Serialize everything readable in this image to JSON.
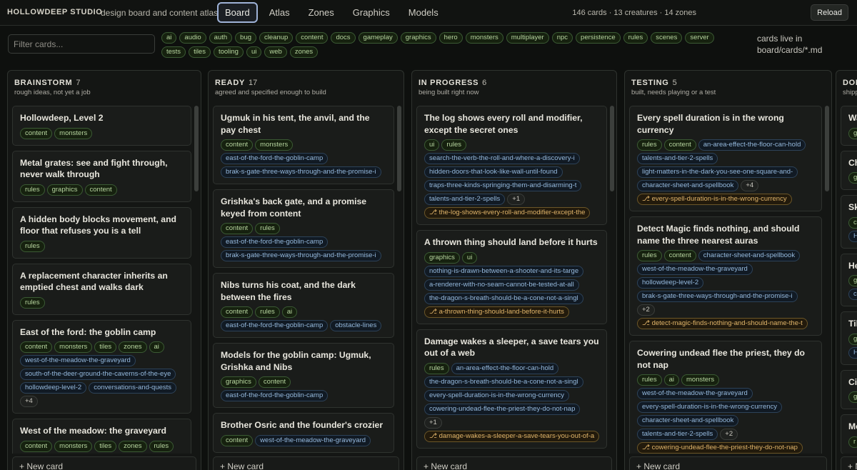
{
  "header": {
    "brand": "HOLLOWDEEP STUDIO",
    "tagline": "design board and content atlas",
    "nav": [
      "Board",
      "Atlas",
      "Zones",
      "Graphics",
      "Models"
    ],
    "active_nav": "Board",
    "stats": "146 cards · 13 creatures · 14 zones",
    "reload_label": "Reload"
  },
  "filter": {
    "placeholder": "Filter cards...",
    "tags": [
      "ai",
      "audio",
      "auth",
      "bug",
      "cleanup",
      "content",
      "docs",
      "gameplay",
      "graphics",
      "hero",
      "monsters",
      "multiplayer",
      "npc",
      "persistence",
      "rules",
      "scenes",
      "server",
      "tests",
      "tiles",
      "tooling",
      "ui",
      "web",
      "zones"
    ],
    "hint": "cards live in board/cards/*.md"
  },
  "new_card_label": "+ New card",
  "columns": [
    {
      "title": "BRAINSTORM",
      "count": "7",
      "subtitle": "rough ideas, not yet a job",
      "cards": [
        {
          "title": "Hollowdeep, Level 2",
          "tags": [
            {
              "t": "content",
              "k": "green"
            },
            {
              "t": "monsters",
              "k": "green"
            }
          ]
        },
        {
          "title": "Metal grates: see and fight through, never walk through",
          "tags": [
            {
              "t": "rules",
              "k": "green"
            },
            {
              "t": "graphics",
              "k": "green"
            },
            {
              "t": "content",
              "k": "green"
            }
          ]
        },
        {
          "title": "A hidden body blocks movement, and floor that refuses you is a tell",
          "tags": [
            {
              "t": "rules",
              "k": "green"
            }
          ]
        },
        {
          "title": "A replacement character inherits an emptied chest and walks dark",
          "tags": [
            {
              "t": "rules",
              "k": "green"
            }
          ]
        },
        {
          "title": "East of the ford: the goblin camp",
          "tags": [
            {
              "t": "content",
              "k": "green"
            },
            {
              "t": "monsters",
              "k": "green"
            },
            {
              "t": "tiles",
              "k": "green"
            },
            {
              "t": "zones",
              "k": "green"
            },
            {
              "t": "ai",
              "k": "green"
            },
            {
              "t": "west-of-the-meadow-the-graveyard",
              "k": "blue"
            },
            {
              "t": "south-of-the-deer-ground-the-caverns-of-the-eye",
              "k": "blue"
            },
            {
              "t": "hollowdeep-level-2",
              "k": "blue"
            },
            {
              "t": "conversations-and-quests",
              "k": "blue"
            },
            {
              "t": "+4",
              "k": "more"
            }
          ]
        },
        {
          "title": "West of the meadow: the graveyard",
          "tags": [
            {
              "t": "content",
              "k": "green"
            },
            {
              "t": "monsters",
              "k": "green"
            },
            {
              "t": "tiles",
              "k": "green"
            },
            {
              "t": "zones",
              "k": "green"
            },
            {
              "t": "rules",
              "k": "green"
            }
          ]
        }
      ]
    },
    {
      "title": "READY",
      "count": "17",
      "subtitle": "agreed and specified enough to build",
      "cards": [
        {
          "title": "Ugmuk in his tent, the anvil, and the pay chest",
          "tags": [
            {
              "t": "content",
              "k": "green"
            },
            {
              "t": "monsters",
              "k": "green"
            },
            {
              "t": "east-of-the-ford-the-goblin-camp",
              "k": "blue"
            },
            {
              "t": "brak-s-gate-three-ways-through-and-the-promise-i",
              "k": "blue"
            }
          ]
        },
        {
          "title": "Grishka's back gate, and a promise keyed from content",
          "tags": [
            {
              "t": "content",
              "k": "green"
            },
            {
              "t": "rules",
              "k": "green"
            },
            {
              "t": "east-of-the-ford-the-goblin-camp",
              "k": "blue"
            },
            {
              "t": "brak-s-gate-three-ways-through-and-the-promise-i",
              "k": "blue"
            }
          ]
        },
        {
          "title": "Nibs turns his coat, and the dark between the fires",
          "tags": [
            {
              "t": "content",
              "k": "green"
            },
            {
              "t": "rules",
              "k": "green"
            },
            {
              "t": "ai",
              "k": "green"
            },
            {
              "t": "east-of-the-ford-the-goblin-camp",
              "k": "blue"
            },
            {
              "t": "obstacle-lines",
              "k": "blue"
            }
          ]
        },
        {
          "title": "Models for the goblin camp: Ugmuk, Grishka and Nibs",
          "tags": [
            {
              "t": "graphics",
              "k": "green"
            },
            {
              "t": "content",
              "k": "green"
            },
            {
              "t": "east-of-the-ford-the-goblin-camp",
              "k": "blue"
            }
          ]
        },
        {
          "title": "Brother Osric and the founder's crozier",
          "tags": [
            {
              "t": "content",
              "k": "green"
            },
            {
              "t": "west-of-the-meadow-the-graveyard",
              "k": "blue"
            }
          ]
        }
      ]
    },
    {
      "title": "IN PROGRESS",
      "count": "6",
      "subtitle": "being built right now",
      "cards": [
        {
          "title": "The log shows every roll and modifier, except the secret ones",
          "tags": [
            {
              "t": "ui",
              "k": "green"
            },
            {
              "t": "rules",
              "k": "green"
            },
            {
              "t": "search-the-verb-the-roll-and-where-a-discovery-i",
              "k": "blue"
            },
            {
              "t": "hidden-doors-that-look-like-wall-until-found",
              "k": "blue"
            },
            {
              "t": "traps-three-kinds-springing-them-and-disarming-t",
              "k": "blue"
            },
            {
              "t": "talents-and-tier-2-spells",
              "k": "blue"
            },
            {
              "t": "+1",
              "k": "more"
            },
            {
              "t": "⎇ the-log-shows-every-roll-and-modifier-except-the",
              "k": "orange"
            }
          ]
        },
        {
          "title": "A thrown thing should land before it hurts",
          "tags": [
            {
              "t": "graphics",
              "k": "green"
            },
            {
              "t": "ui",
              "k": "green"
            },
            {
              "t": "nothing-is-drawn-between-a-shooter-and-its-targe",
              "k": "blue"
            },
            {
              "t": "a-renderer-with-no-seam-cannot-be-tested-at-all",
              "k": "blue"
            },
            {
              "t": "the-dragon-s-breath-should-be-a-cone-not-a-singl",
              "k": "blue"
            },
            {
              "t": "⎇ a-thrown-thing-should-land-before-it-hurts",
              "k": "orange"
            }
          ]
        },
        {
          "title": "Damage wakes a sleeper, a save tears you out of a web",
          "tags": [
            {
              "t": "rules",
              "k": "green"
            },
            {
              "t": "an-area-effect-the-floor-can-hold",
              "k": "blue"
            },
            {
              "t": "the-dragon-s-breath-should-be-a-cone-not-a-singl",
              "k": "blue"
            },
            {
              "t": "every-spell-duration-is-in-the-wrong-currency",
              "k": "blue"
            },
            {
              "t": "cowering-undead-flee-the-priest-they-do-not-nap",
              "k": "blue"
            },
            {
              "t": "+1",
              "k": "more"
            },
            {
              "t": "⎇ damage-wakes-a-sleeper-a-save-tears-you-out-of-a",
              "k": "orange"
            }
          ]
        }
      ]
    },
    {
      "title": "TESTING",
      "count": "5",
      "subtitle": "built, needs playing or a test",
      "cards": [
        {
          "title": "Every spell duration is in the wrong currency",
          "tags": [
            {
              "t": "rules",
              "k": "green"
            },
            {
              "t": "content",
              "k": "green"
            },
            {
              "t": "an-area-effect-the-floor-can-hold",
              "k": "blue"
            },
            {
              "t": "talents-and-tier-2-spells",
              "k": "blue"
            },
            {
              "t": "light-matters-in-the-dark-you-see-one-square-and-",
              "k": "blue"
            },
            {
              "t": "character-sheet-and-spellbook",
              "k": "blue"
            },
            {
              "t": "+4",
              "k": "more"
            },
            {
              "t": "⎇ every-spell-duration-is-in-the-wrong-currency",
              "k": "orange"
            }
          ]
        },
        {
          "title": "Detect Magic finds nothing, and should name the three nearest auras",
          "tags": [
            {
              "t": "rules",
              "k": "green"
            },
            {
              "t": "content",
              "k": "green"
            },
            {
              "t": "character-sheet-and-spellbook",
              "k": "blue"
            },
            {
              "t": "west-of-the-meadow-the-graveyard",
              "k": "blue"
            },
            {
              "t": "hollowdeep-level-2",
              "k": "blue"
            },
            {
              "t": "brak-s-gate-three-ways-through-and-the-promise-i",
              "k": "blue"
            },
            {
              "t": "+2",
              "k": "more"
            },
            {
              "t": "⎇ detect-magic-finds-nothing-and-should-name-the-t",
              "k": "orange"
            }
          ]
        },
        {
          "title": "Cowering undead flee the priest, they do not nap",
          "tags": [
            {
              "t": "rules",
              "k": "green"
            },
            {
              "t": "ai",
              "k": "green"
            },
            {
              "t": "monsters",
              "k": "green"
            },
            {
              "t": "west-of-the-meadow-the-graveyard",
              "k": "blue"
            },
            {
              "t": "every-spell-duration-is-in-the-wrong-currency",
              "k": "blue"
            },
            {
              "t": "character-sheet-and-spellbook",
              "k": "blue"
            },
            {
              "t": "talents-and-tier-2-spells",
              "k": "blue"
            },
            {
              "t": "+2",
              "k": "more"
            },
            {
              "t": "⎇ cowering-undead-flee-the-priest-they-do-not-nap",
              "k": "orange"
            }
          ]
        }
      ]
    },
    {
      "title": "DONE",
      "count": "",
      "subtitle": "shipped",
      "cards": [
        {
          "title": "Wa",
          "tags": [
            {
              "t": "g",
              "k": "green"
            }
          ]
        },
        {
          "title": "Ch",
          "tags": [
            {
              "t": "g",
              "k": "green"
            }
          ]
        },
        {
          "title": "Sk",
          "tags": [
            {
              "t": "c",
              "k": "green"
            },
            {
              "t": "H",
              "k": "blue"
            }
          ]
        },
        {
          "title": "He ha",
          "tags": [
            {
              "t": "g",
              "k": "green"
            },
            {
              "t": "c",
              "k": "blue"
            }
          ]
        },
        {
          "title": "Til",
          "tags": [
            {
              "t": "g",
              "k": "green"
            },
            {
              "t": "H",
              "k": "blue"
            }
          ]
        },
        {
          "title": "Cis",
          "tags": [
            {
              "t": "g",
              "k": "green"
            }
          ]
        },
        {
          "title": "Mc",
          "tags": [
            {
              "t": "r",
              "k": "green"
            }
          ]
        }
      ]
    }
  ],
  "colors": {
    "accent": "#9fb3d8",
    "tag_green": "#b7d59f",
    "tag_blue": "#95b9dd",
    "tag_orange": "#e1b56a",
    "bg": "#0e100e"
  }
}
